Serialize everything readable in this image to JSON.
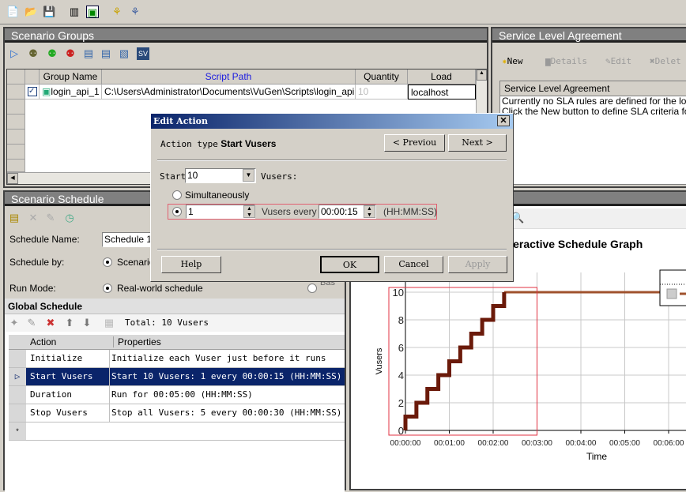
{
  "toolbar": {
    "icons": [
      "new-scenario-icon",
      "open-icon",
      "save-icon",
      "vuser-icon",
      "load-generators-icon",
      "run-icon",
      "analysis-icon"
    ]
  },
  "scenario_groups": {
    "title": "Scenario Groups",
    "toolbar_icons": [
      "start-icon",
      "vusers-icon",
      "add-group-icon",
      "remove-group-icon",
      "run-time-settings-icon",
      "details-icon",
      "view-script-icon",
      "service-virtualization-icon"
    ],
    "columns": [
      "Group Name",
      "Script Path",
      "Quantity",
      "Load Generators"
    ],
    "rows": [
      {
        "checked": true,
        "group_name": "login_api_1",
        "script_path": "C:\\Users\\Administrator\\Documents\\VuGen\\Scripts\\login_api",
        "quantity": "10",
        "load_generator": "localhost"
      }
    ]
  },
  "sla": {
    "title": "Service Level Agreement",
    "buttons": {
      "new": "New",
      "details": "Details",
      "edit": "Edit",
      "delete": "Delet"
    },
    "list_header": "Service Level Agreement",
    "lines": [
      "Currently no SLA rules are defined for the load t",
      "Click the New button to define SLA criteria for y"
    ]
  },
  "schedule": {
    "title": "Scenario Schedule",
    "name_label": "Schedule Name:",
    "name_value": "Schedule 1",
    "by_label": "Schedule by:",
    "by_value": "Scenario",
    "run_mode_label": "Run Mode:",
    "run_mode_value": "Real-world schedule",
    "run_mode_other": "Bas",
    "global_title": "Global Schedule",
    "total": "Total: 10 Vusers",
    "columns": [
      "Action",
      "Properties"
    ],
    "rows": [
      {
        "action": "Initialize",
        "properties": "Initialize each Vuser just before it runs",
        "selected": false
      },
      {
        "action": "Start  Vusers",
        "properties": "Start 10 Vusers: 1 every 00:00:15 (HH:MM:SS)",
        "selected": true
      },
      {
        "action": "Duration",
        "properties": "Run for 00:05:00 (HH:MM:SS)",
        "selected": false
      },
      {
        "action": "Stop Vusers",
        "properties": "Stop all Vusers: 5 every 00:00:30 (HH:MM:SS)",
        "selected": false
      }
    ],
    "new_row_marker": "*"
  },
  "graph": {
    "title": "Interactive Schedule Graph"
  },
  "chart_data": {
    "type": "line",
    "title": "Interactive Schedule Graph",
    "xlabel": "Time",
    "ylabel": "Vusers",
    "x_ticks": [
      "00:00:00",
      "00:01:00",
      "00:02:00",
      "00:03:00",
      "00:04:00",
      "00:05:00",
      "00:06:00"
    ],
    "y_ticks": [
      "0",
      "2",
      "4",
      "6",
      "8",
      "10"
    ],
    "ylim": [
      0,
      10
    ],
    "grid": true,
    "series": [
      {
        "x": [
          "00:00:00",
          "00:00:00",
          "00:00:15",
          "00:00:30",
          "00:00:45",
          "00:01:00",
          "00:01:15",
          "00:01:30",
          "00:01:45",
          "00:02:00",
          "00:02:15"
        ],
        "y": [
          0,
          1,
          2,
          3,
          4,
          5,
          6,
          7,
          8,
          9,
          10
        ]
      }
    ],
    "hold_value": 10,
    "colors": {
      "ramp": "#6b1a0a",
      "hold": "#a0522d",
      "highlight": "#e03040"
    }
  },
  "dialog": {
    "title": "Edit Action",
    "action_type_label": "Action type",
    "action_type_value": "Start Vusers",
    "previous": "< Previou",
    "next": "Next >",
    "start_label": "Start",
    "start_value": "10",
    "vusers_label": "Vusers:",
    "simultaneously": "Simultaneously",
    "every_count": "1",
    "every_label": "Vusers every",
    "every_time": "00:00:15",
    "time_format": "(HH:MM:SS)",
    "help": "Help",
    "ok": "OK",
    "cancel": "Cancel",
    "apply": "Apply"
  }
}
